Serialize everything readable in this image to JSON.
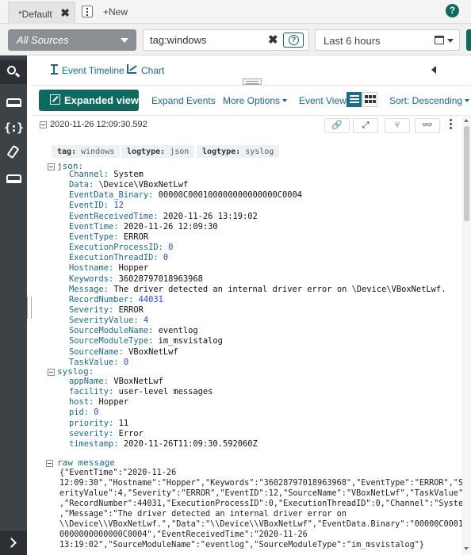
{
  "tabs": {
    "active_label": "*Default",
    "close_glyph": "✖",
    "new_label": "+New",
    "help_glyph": "?"
  },
  "search": {
    "source_label": "All Sources",
    "query_value": "tag:windows",
    "query_help_glyph": "?",
    "clear_glyph": "✖",
    "time_range": "Last 6 hours"
  },
  "sidebar": {
    "json_icon_text": "{:}"
  },
  "viewbar": {
    "timeline_label": "Event Timeline",
    "chart_label": "Chart"
  },
  "actionbar": {
    "expanded_view_label": "Expanded view",
    "expand_events_label": "Expand Events",
    "more_options_label": "More Options",
    "event_view_label": "Event View",
    "sort_label": "Sort: Descending"
  },
  "event": {
    "timestamp": "2020-11-26 12:09:30.592",
    "actions": {
      "link_glyph": "🔗",
      "expand_glyph": "⤢",
      "fork_glyph": "⑂",
      "bino_glyph": "👓"
    },
    "tags": [
      {
        "key": "tag",
        "value": "windows"
      },
      {
        "key": "logtype",
        "value": "json"
      },
      {
        "key": "logtype",
        "value": "syslog"
      }
    ],
    "json_label": "json:",
    "json_fields": [
      {
        "key": "Channel",
        "value": "System",
        "numeric": false
      },
      {
        "key": "Data",
        "value": "\\Device\\VBoxNetLwf",
        "numeric": false
      },
      {
        "key": "EventData_Binary",
        "value": "00000C000100000000000000C0004",
        "numeric": false
      },
      {
        "key": "EventID",
        "value": "12",
        "numeric": true
      },
      {
        "key": "EventReceivedTime",
        "value": "2020-11-26 13:19:02",
        "numeric": false
      },
      {
        "key": "EventTime",
        "value": "2020-11-26 12:09:30",
        "numeric": false
      },
      {
        "key": "EventType",
        "value": "ERROR",
        "numeric": false
      },
      {
        "key": "ExecutionProcessID",
        "value": "0",
        "numeric": true
      },
      {
        "key": "ExecutionThreadID",
        "value": "0",
        "numeric": true
      },
      {
        "key": "Hostname",
        "value": "Hopper",
        "numeric": false
      },
      {
        "key": "Keywords",
        "value": "36028797018963968",
        "numeric": false
      },
      {
        "key": "Message",
        "value": "The driver detected an internal driver error on \\Device\\VBoxNetLwf.",
        "numeric": false
      },
      {
        "key": "RecordNumber",
        "value": "44031",
        "numeric": true
      },
      {
        "key": "Severity",
        "value": "ERROR",
        "numeric": false
      },
      {
        "key": "SeverityValue",
        "value": "4",
        "numeric": true
      },
      {
        "key": "SourceModuleName",
        "value": "eventlog",
        "numeric": false
      },
      {
        "key": "SourceModuleType",
        "value": "im_msvistalog",
        "numeric": false
      },
      {
        "key": "SourceName",
        "value": "VBoxNetLwf",
        "numeric": false
      },
      {
        "key": "TaskValue",
        "value": "0",
        "numeric": true
      }
    ],
    "syslog_label": "syslog:",
    "syslog_fields": [
      {
        "key": "appName",
        "value": "VBoxNetLwf",
        "numeric": false
      },
      {
        "key": "facility",
        "value": "user-level messages",
        "numeric": false
      },
      {
        "key": "host",
        "value": "Hopper",
        "numeric": false
      },
      {
        "key": "pid",
        "value": "0",
        "numeric": true
      },
      {
        "key": "priority",
        "value": "11",
        "numeric": false
      },
      {
        "key": "severity",
        "value": "Error",
        "numeric": false
      },
      {
        "key": "timestamp",
        "value": "2020-11-26T11:09:30.592060Z",
        "numeric": false
      }
    ],
    "raw_label": "raw message",
    "raw_lines": [
      "{\"EventTime\":\"2020-11-26",
      "12:09:30\",\"Hostname\":\"Hopper\",\"Keywords\":\"36028797018963968\",\"EventType\":\"ERROR\",\"Sev",
      "erityValue\":4,\"Severity\":\"ERROR\",\"EventID\":12,\"SourceName\":\"VBoxNetLwf\",\"TaskValue\":0",
      ",\"RecordNumber\":44031,\"ExecutionProcessID\":0,\"ExecutionThreadID\":0,\"Channel\":\"System\"",
      ",\"Message\":\"The driver detected an internal driver error on",
      "\\\\Device\\\\VBoxNetLwf.\",\"Data\":\"\\\\Device\\\\VBoxNetLwf\",\"EventData.Binary\":\"00000C000100",
      "0000000000000C0004\",\"EventReceivedTime\":\"2020-11-26",
      "13:19:02\",\"SourceModuleName\":\"eventlog\",\"SourceModuleType\":\"im_msvistalog\"}"
    ]
  }
}
